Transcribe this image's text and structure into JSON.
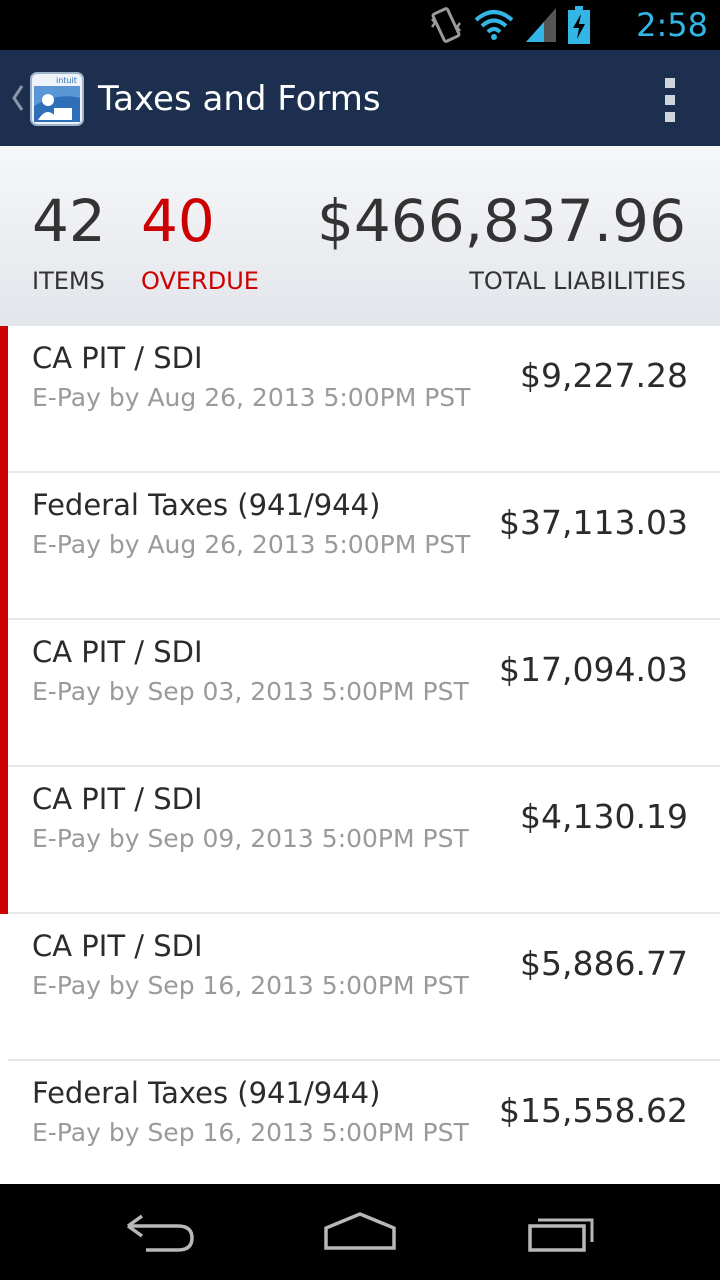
{
  "status_bar": {
    "time": "2:58",
    "icons": [
      "vibrate-icon",
      "wifi-icon",
      "signal-icon",
      "battery-charging-icon"
    ]
  },
  "action_bar": {
    "title": "Taxes and Forms",
    "logo_text": "intuit",
    "icons": [
      "up-caret-icon",
      "app-logo",
      "overflow-menu-icon"
    ]
  },
  "summary": {
    "items_count": "42",
    "items_label": "ITEMS",
    "overdue_count": "40",
    "overdue_label": "OVERDUE",
    "total_amount": "$466,837.96",
    "total_label": "TOTAL LIABILITIES"
  },
  "colors": {
    "action_bar": "#1c2f4e",
    "overdue": "#cc0000",
    "accent": "#33b5e5"
  },
  "liabilities": [
    {
      "name": "CA PIT / SDI",
      "due": "E-Pay by Aug 26, 2013 5:00PM PST",
      "amount": "$9,227.28",
      "overdue": true
    },
    {
      "name": "Federal Taxes (941/944)",
      "due": "E-Pay by Aug 26, 2013 5:00PM PST",
      "amount": "$37,113.03",
      "overdue": true
    },
    {
      "name": "CA PIT / SDI",
      "due": "E-Pay by Sep 03, 2013 5:00PM PST",
      "amount": "$17,094.03",
      "overdue": true
    },
    {
      "name": "CA PIT / SDI",
      "due": "E-Pay by Sep 09, 2013 5:00PM PST",
      "amount": "$4,130.19",
      "overdue": true
    },
    {
      "name": "CA PIT / SDI",
      "due": "E-Pay by Sep 16, 2013 5:00PM PST",
      "amount": "$5,886.77",
      "overdue": false
    },
    {
      "name": "Federal Taxes (941/944)",
      "due": "E-Pay by Sep 16, 2013 5:00PM PST",
      "amount": "$15,558.62",
      "overdue": false
    }
  ],
  "nav_bar": {
    "icons": [
      "back-icon",
      "home-icon",
      "recents-icon"
    ]
  }
}
